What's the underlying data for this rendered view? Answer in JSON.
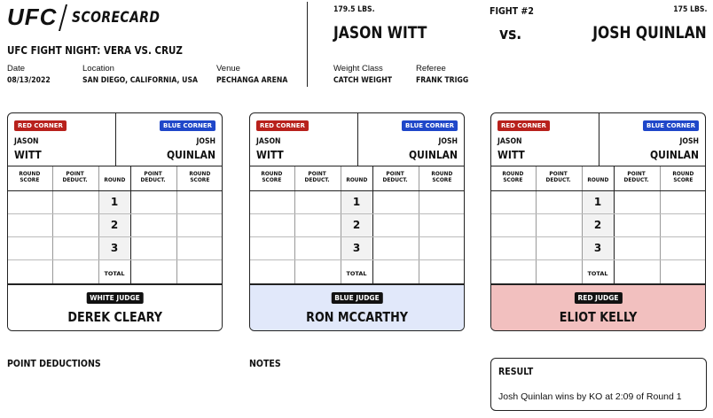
{
  "brand": {
    "logo_text": "UFC",
    "title": "SCORECARD"
  },
  "event": {
    "name": "UFC FIGHT NIGHT: VERA VS. CRUZ",
    "date_label": "Date",
    "date": "08/13/2022",
    "location_label": "Location",
    "location": "SAN DIEGO, CALIFORNIA, USA",
    "venue_label": "Venue",
    "venue": "PECHANGA ARENA"
  },
  "fight": {
    "fight_number": "FIGHT #2",
    "vs_text": "vs.",
    "red_fighter": {
      "weight": "179.5 LBS.",
      "full_name": "JASON WITT"
    },
    "blue_fighter": {
      "weight": "175 LBS.",
      "full_name": "JOSH QUINLAN"
    },
    "weight_class_label": "Weight Class",
    "weight_class": "CATCH WEIGHT",
    "referee_label": "Referee",
    "referee": "FRANK TRIGG"
  },
  "scorecard": {
    "red_corner_label": "RED CORNER",
    "blue_corner_label": "BLUE CORNER",
    "red_first": "JASON",
    "red_last": "WITT",
    "blue_first": "JOSH",
    "blue_last": "QUINLAN",
    "col_round_score": "ROUND SCORE",
    "col_point_deduct": "POINT DEDUCT.",
    "col_round": "ROUND",
    "rounds": [
      "1",
      "2",
      "3"
    ],
    "total_label": "TOTAL"
  },
  "judges": [
    {
      "badge": "WHITE JUDGE",
      "name": "DEREK CLEARY",
      "panel_color": "#ffffff"
    },
    {
      "badge": "BLUE JUDGE",
      "name": "RON MCCARTHY",
      "panel_color": "#e1e8fa"
    },
    {
      "badge": "RED JUDGE",
      "name": "ELIOT KELLY",
      "panel_color": "#f2c0bf"
    }
  ],
  "sections": {
    "point_deductions": "POINT DEDUCTIONS",
    "notes": "NOTES"
  },
  "result": {
    "title": "RESULT",
    "text": "Josh Quinlan wins by KO at 2:09 of Round 1"
  },
  "colors": {
    "red": "#b8211c",
    "blue": "#1f47c9",
    "ink": "#111111"
  }
}
